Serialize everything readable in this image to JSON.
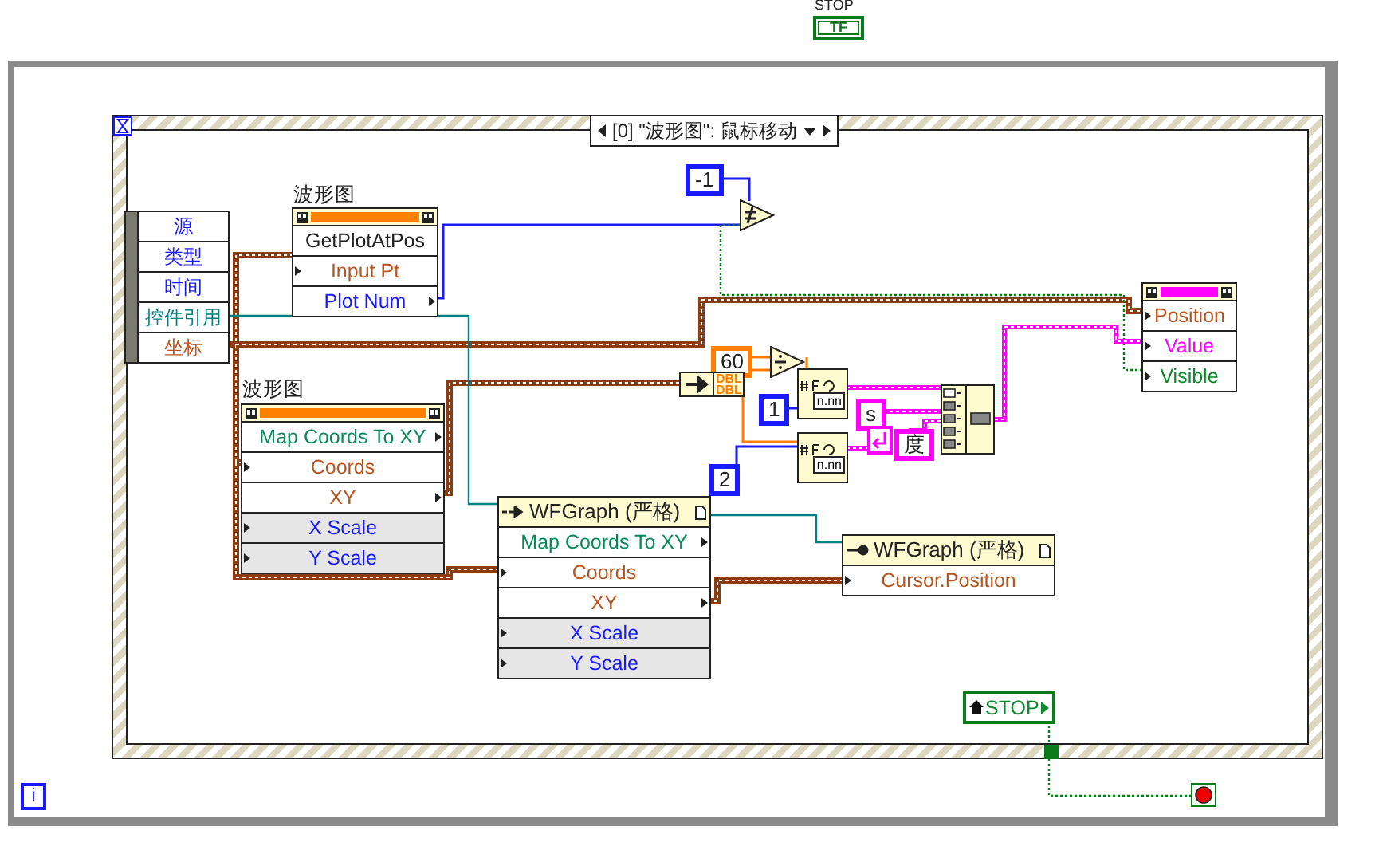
{
  "stop_indicator": {
    "label": "STOP",
    "text": "TF"
  },
  "case_selector": {
    "text": "[0] \"波形图\": 鼠标移动"
  },
  "event_data": {
    "items": [
      {
        "name": "源",
        "color": "#1a1aff"
      },
      {
        "name": "类型",
        "color": "#1a1aff"
      },
      {
        "name": "时间",
        "color": "#1a1aff"
      },
      {
        "name": "控件引用",
        "color": "#008080"
      },
      {
        "name": "坐标",
        "color": "#b8541c"
      }
    ]
  },
  "nodes": [
    {
      "kind": "invoke",
      "label": "波形图",
      "rows": [
        {
          "name": "GetPlotAtPos",
          "kind": "method",
          "input": false,
          "output": false
        },
        {
          "name": "Input Pt",
          "kind": "cluster",
          "input": true,
          "output": false
        },
        {
          "name": "Plot Num",
          "kind": "numeric",
          "input": false,
          "output": true
        }
      ]
    },
    {
      "kind": "invoke",
      "label": "波形图",
      "rows": [
        {
          "name": "Map Coords To XY",
          "kind": "ref",
          "input": false,
          "output": true
        },
        {
          "name": "Coords",
          "kind": "cluster",
          "input": true,
          "output": false
        },
        {
          "name": "XY",
          "kind": "cluster",
          "input": false,
          "output": true
        },
        {
          "name": "X Scale",
          "kind": "scale",
          "input": true,
          "output": false
        },
        {
          "name": "Y Scale",
          "kind": "scale",
          "input": true,
          "output": false
        }
      ]
    },
    {
      "kind": "ref_invoke",
      "title": "WFGraph (严格)",
      "rows": [
        {
          "name": "Map Coords To XY",
          "kind": "ref",
          "input": false,
          "output": true
        },
        {
          "name": "Coords",
          "kind": "cluster",
          "input": true,
          "output": false
        },
        {
          "name": "XY",
          "kind": "cluster",
          "input": false,
          "output": true
        },
        {
          "name": "X Scale",
          "kind": "scale",
          "input": true,
          "output": false
        },
        {
          "name": "Y Scale",
          "kind": "scale",
          "input": true,
          "output": false
        }
      ]
    },
    {
      "kind": "ref_property",
      "title": "WFGraph (严格)",
      "rows": [
        {
          "name": "Cursor.Position",
          "kind": "cluster",
          "input": true,
          "output": false
        }
      ]
    },
    {
      "kind": "property",
      "rows": [
        {
          "name": "Position",
          "kind": "cluster",
          "input": true,
          "output": false
        },
        {
          "name": "Value",
          "kind": "string",
          "input": true,
          "output": false
        },
        {
          "name": "Visible",
          "kind": "bool",
          "input": true,
          "output": false
        }
      ]
    }
  ],
  "constants": [
    {
      "text": "-1",
      "kind": "numeric"
    },
    {
      "text": "60",
      "kind": "double"
    },
    {
      "text": "1",
      "kind": "numeric"
    },
    {
      "text": "2",
      "kind": "numeric"
    },
    {
      "text": "s",
      "kind": "string"
    },
    {
      "text": "度",
      "kind": "string"
    }
  ],
  "unbundle": {
    "types": [
      "DBL",
      "DBL"
    ]
  },
  "format_nodes": [
    {
      "format": "n.nn"
    },
    {
      "format": "n.nn"
    }
  ],
  "stop_control": {
    "text": "STOP"
  },
  "iteration": {
    "text": "i"
  }
}
